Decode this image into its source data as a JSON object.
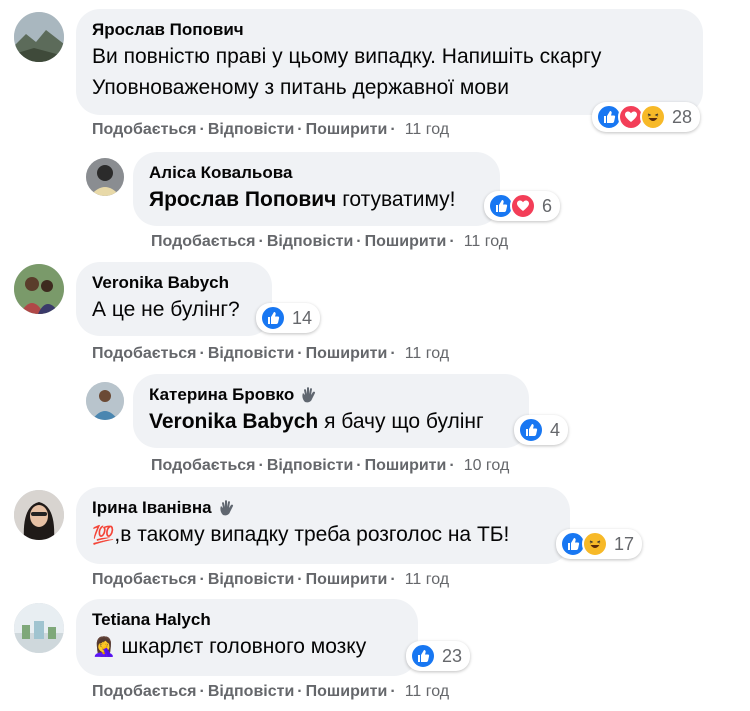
{
  "actions": {
    "like": "Подобається",
    "reply": "Відповісти",
    "share": "Поширити",
    "separator": "·"
  },
  "comments": [
    {
      "author": "Ярослав Попович",
      "line1": "Ви повністю праві у цьому випадку. Напишіть скаргу",
      "line2": "Уповноваженому з питань державної мови",
      "reactions": [
        "like",
        "love",
        "haha"
      ],
      "count": "28",
      "time": "11 год"
    },
    {
      "author": "Аліса Ковальова",
      "mention": "Ярослав Попович",
      "text": " готуватиму!",
      "reactions": [
        "like",
        "love"
      ],
      "count": "6",
      "time": "11 год"
    },
    {
      "author": "Veronika Babych",
      "text": "А це не булінг?",
      "reactions": [
        "like"
      ],
      "count": "14",
      "time": "11 год"
    },
    {
      "author": "Катерина Бровко",
      "mention": "Veronika Babych",
      "text": " я бачу що булінг",
      "reactions": [
        "like"
      ],
      "count": "4",
      "time": "10 год"
    },
    {
      "author": "Ірина Іванівна",
      "emoji": "💯",
      "text": ",в такому випадку треба розголос на ТБ!",
      "reactions": [
        "like",
        "haha"
      ],
      "count": "17",
      "time": "11 год"
    },
    {
      "author": "Tetiana Halych",
      "emoji": "🤦‍♀️",
      "text": " шкарлєт головного мозку",
      "reactions": [
        "like"
      ],
      "count": "23",
      "time": "11 год"
    }
  ],
  "colors": {
    "bubble": "#f0f2f5",
    "like": "#1877f2",
    "love": "#f33e58",
    "haha": "#f7b928",
    "meta": "#65676b"
  }
}
